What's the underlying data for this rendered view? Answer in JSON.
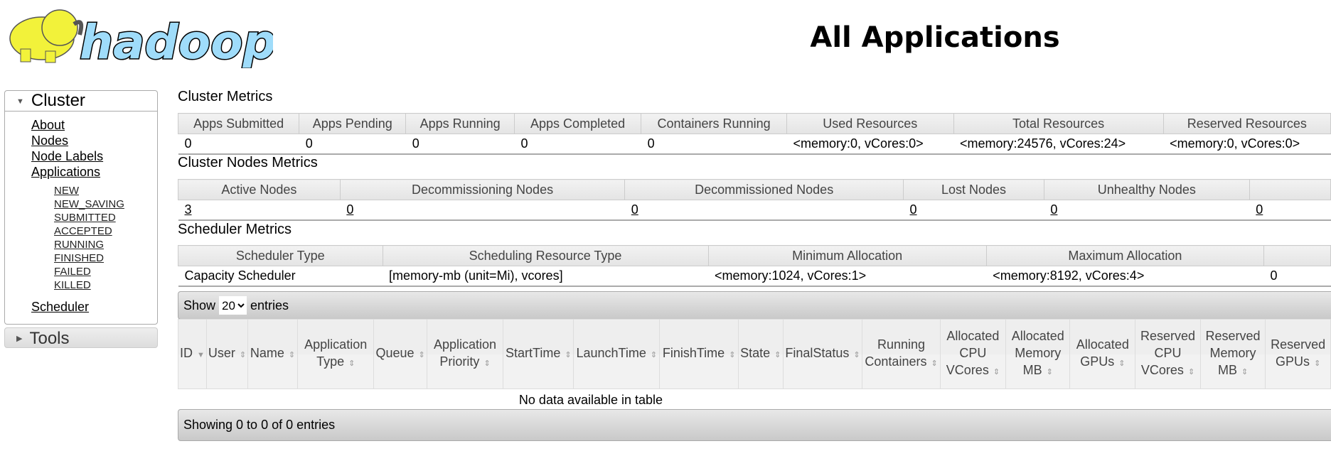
{
  "logo_text": "hadoop",
  "page_title": "All Applications",
  "sidebar": {
    "cluster": "Cluster",
    "links": [
      "About",
      "Nodes",
      "Node Labels",
      "Applications"
    ],
    "app_states": [
      "NEW",
      "NEW_SAVING",
      "SUBMITTED",
      "ACCEPTED",
      "RUNNING",
      "FINISHED",
      "FAILED",
      "KILLED"
    ],
    "scheduler": "Scheduler",
    "tools": "Tools"
  },
  "cluster_metrics": {
    "title": "Cluster Metrics",
    "headers": [
      "Apps Submitted",
      "Apps Pending",
      "Apps Running",
      "Apps Completed",
      "Containers Running",
      "Used Resources",
      "Total Resources",
      "Reserved Resources"
    ],
    "values": [
      "0",
      "0",
      "0",
      "0",
      "0",
      "<memory:0, vCores:0>",
      "<memory:24576, vCores:24>",
      "<memory:0, vCores:0>"
    ]
  },
  "nodes_metrics": {
    "title": "Cluster Nodes Metrics",
    "headers": [
      "Active Nodes",
      "Decommissioning Nodes",
      "Decommissioned Nodes",
      "Lost Nodes",
      "Unhealthy Nodes",
      ""
    ],
    "values": [
      "3",
      "0",
      "0",
      "0",
      "0",
      "0"
    ]
  },
  "scheduler_metrics": {
    "title": "Scheduler Metrics",
    "headers": [
      "Scheduler Type",
      "Scheduling Resource Type",
      "Minimum Allocation",
      "Maximum Allocation",
      ""
    ],
    "values": [
      "Capacity Scheduler",
      "[memory-mb (unit=Mi), vcores]",
      "<memory:1024, vCores:1>",
      "<memory:8192, vCores:4>",
      "0"
    ]
  },
  "apps_table": {
    "show": "Show",
    "page_size": "20",
    "entries": "entries",
    "columns": [
      "ID",
      "User",
      "Name",
      "Application Type",
      "Queue",
      "Application Priority",
      "StartTime",
      "LaunchTime",
      "FinishTime",
      "State",
      "FinalStatus",
      "Running Containers",
      "Allocated CPU VCores",
      "Allocated Memory MB",
      "Allocated GPUs",
      "Reserved CPU VCores",
      "Reserved Memory MB",
      "Reserved GPUs"
    ],
    "empty": "No data available in table",
    "info": "Showing 0 to 0 of 0 entries"
  }
}
